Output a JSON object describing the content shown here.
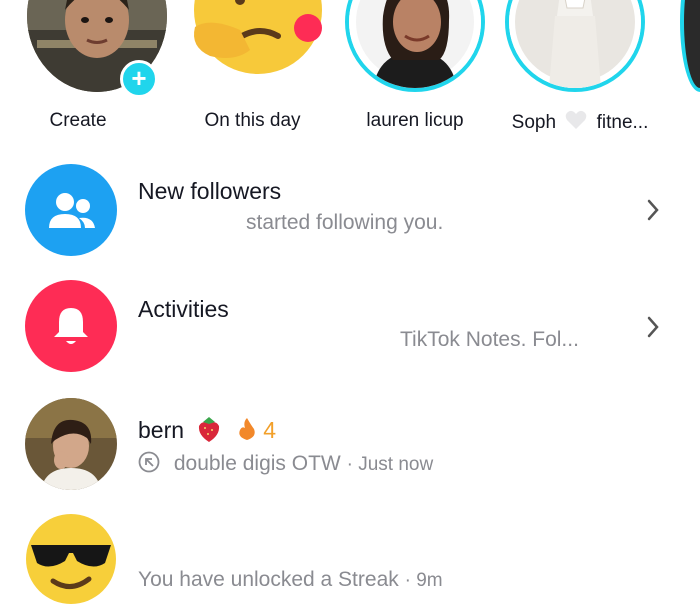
{
  "stories": [
    {
      "label": "Create"
    },
    {
      "label": "On this day"
    },
    {
      "label": "lauren licup"
    },
    {
      "label": "Soph",
      "label_suffix": "fitne..."
    }
  ],
  "rows": {
    "new_followers": {
      "title": "New followers",
      "subtitle": "started following you."
    },
    "activities": {
      "title": "Activities",
      "subtitle": "TikTok Notes. Fol..."
    },
    "bern": {
      "name": "bern",
      "streak": "4",
      "message": "double digis OTW",
      "time": "· Just now"
    },
    "streak": {
      "message": "You have unlocked a Streak",
      "time": "· 9m"
    }
  },
  "colors": {
    "followers_blue": "#1da1f2",
    "activities_pink": "#fe2c55",
    "story_ring_teal": "#20d5ec",
    "create_plus": "#20d5ec",
    "streak_orange": "#f2a02a"
  }
}
